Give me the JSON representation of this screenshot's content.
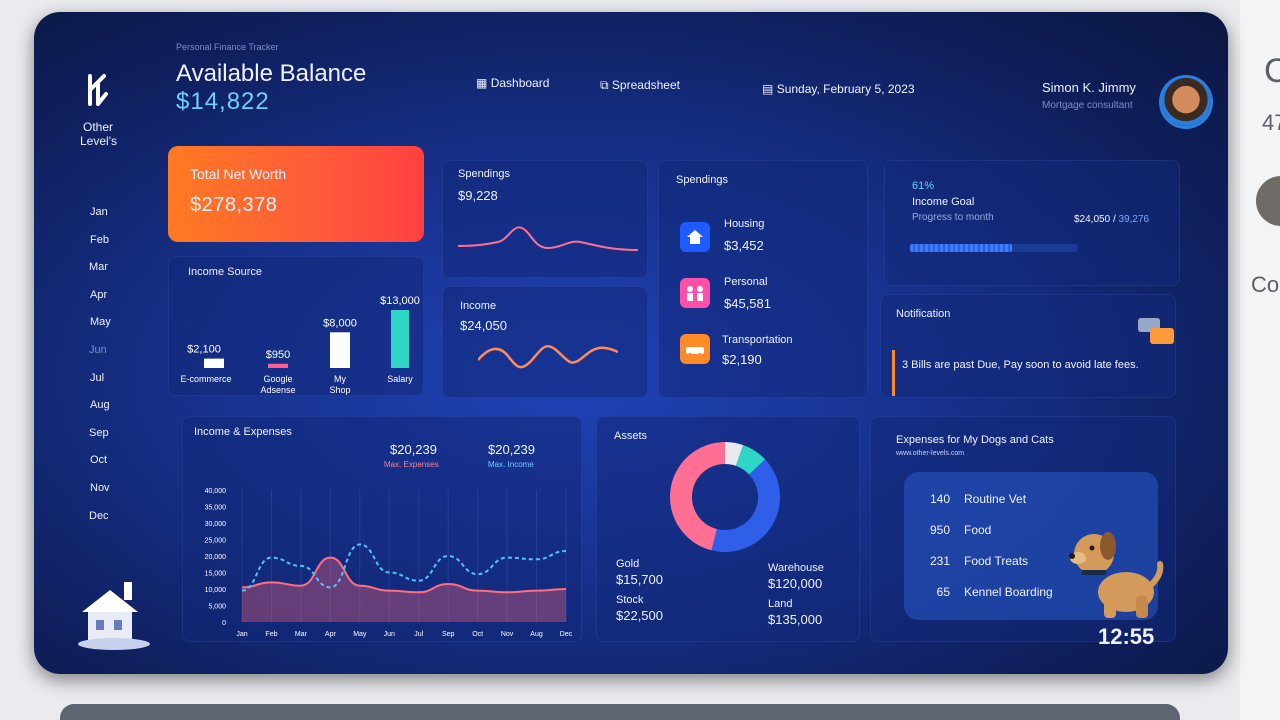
{
  "header": {
    "subtitle": "Personal Finance Tracker",
    "title": "Available Balance",
    "balance": "$14,822",
    "nav": [
      {
        "label": "Dashboard",
        "icon": "grid-icon"
      },
      {
        "label": "Spreadsheet",
        "icon": "link-icon"
      }
    ],
    "date": "Sunday, February 5, 2023",
    "user_name": "Simon K. Jimmy",
    "user_role": "Mortgage consultant"
  },
  "sidebar": {
    "brand": "Other Level's",
    "months": [
      "Jan",
      "Feb",
      "Mar",
      "Apr",
      "May",
      "Jun",
      "Jul",
      "Aug",
      "Sep",
      "Oct",
      "Nov",
      "Dec"
    ],
    "active_month": "Jun"
  },
  "net_worth": {
    "title": "Total Net Worth",
    "value": "$278,378"
  },
  "income_source": {
    "title": "Income Source",
    "chart_data": {
      "type": "bar",
      "categories": [
        "E-commerce",
        "Google Adsense",
        "My Shop",
        "Salary"
      ],
      "values": [
        2100,
        950,
        8000,
        13000
      ],
      "value_labels": [
        "$2,100",
        "$950",
        "$8,000",
        "$13,000"
      ],
      "colors": [
        "#ffffff",
        "#ff5f8a",
        "#ffffff",
        "#2fd6c6"
      ]
    }
  },
  "spendings_mini": {
    "title": "Spendings",
    "value": "$9,228"
  },
  "income_mini": {
    "title": "Income",
    "value": "$24,050"
  },
  "spendings": {
    "title": "Spendings",
    "items": [
      {
        "label": "Housing",
        "value": "$3,452",
        "icon": "house-icon",
        "color": "#1f5bff"
      },
      {
        "label": "Personal",
        "value": "$45,581",
        "icon": "people-icon",
        "color": "#ff4fa8"
      },
      {
        "label": "Transportation",
        "value": "$2,190",
        "icon": "car-icon",
        "color": "#ff8a2a"
      }
    ]
  },
  "income_goal": {
    "percent_label": "61%",
    "percent": 0.61,
    "title": "Income Goal",
    "subtitle": "Progress to month",
    "current": "$24,050",
    "separator": "/",
    "target": "39,276"
  },
  "notification": {
    "title": "Notification",
    "message": "3 Bills are past Due, Pay soon to avoid late fees."
  },
  "income_expenses": {
    "title": "Income & Expenses",
    "max_expenses_value": "$20,239",
    "max_expenses_label": "Max. Expenses",
    "max_income_value": "$20,239",
    "max_income_label": "Max. Income",
    "chart_data": {
      "type": "line",
      "x": [
        "Jan",
        "Feb",
        "Mar",
        "Apr",
        "May",
        "Jun",
        "Jul",
        "Sep",
        "Oct",
        "Nov",
        "Aug",
        "Dec"
      ],
      "y_ticks": [
        "40,000",
        "35,000",
        "30,000",
        "25,000",
        "20,000",
        "15,000",
        "10,000",
        "5,000",
        "0"
      ],
      "ylim": [
        0,
        40000
      ],
      "series": [
        {
          "name": "Expenses",
          "values": [
            10500,
            12000,
            11000,
            19500,
            11000,
            9500,
            9000,
            11500,
            9500,
            9000,
            9500,
            10000
          ],
          "color": "#ff6f7d",
          "style": "area"
        },
        {
          "name": "Income",
          "values": [
            9500,
            19500,
            17000,
            10500,
            23500,
            15000,
            12500,
            20000,
            14500,
            19500,
            19000,
            21500
          ],
          "color": "#4fc3ff",
          "style": "dashed"
        }
      ]
    }
  },
  "assets": {
    "title": "Assets",
    "chart_data": {
      "type": "pie",
      "categories": [
        "Gold",
        "Stock",
        "Warehouse",
        "Land"
      ],
      "values": [
        15700,
        22500,
        120000,
        135000
      ],
      "colors": [
        "#e8e8f0",
        "#2fd6c6",
        "#2f5fe8",
        "#ff6f93"
      ]
    },
    "items": [
      {
        "label": "Gold",
        "value": "$15,700"
      },
      {
        "label": "Stock",
        "value": "$22,500"
      },
      {
        "label": "Warehouse",
        "value": "$120,000"
      },
      {
        "label": "Land",
        "value": "$135,000"
      }
    ]
  },
  "pets": {
    "title": "Expenses for My Dogs and Cats",
    "source": "www.other-levels.com",
    "items": [
      {
        "value": "140",
        "label": "Routine Vet"
      },
      {
        "value": "950",
        "label": "Food"
      },
      {
        "value": "231",
        "label": "Food Treats"
      },
      {
        "value": "65",
        "label": "Kennel Boarding"
      }
    ]
  },
  "video_time": "12:55",
  "page_edge": {
    "cut1": "C",
    "cut2": "47",
    "cut3": "Co"
  }
}
